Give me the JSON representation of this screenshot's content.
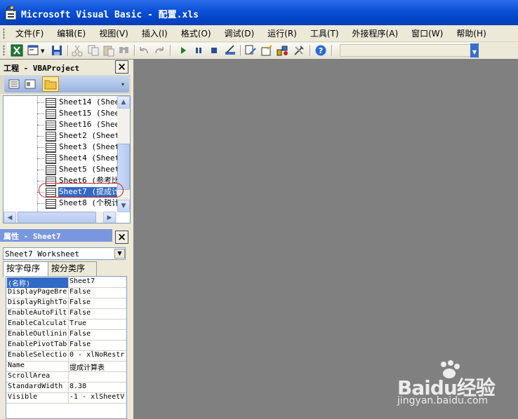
{
  "window": {
    "title": "Microsoft Visual Basic - 配置.xls"
  },
  "menu": [
    "文件(F)",
    "编辑(E)",
    "视图(V)",
    "插入(I)",
    "格式(O)",
    "调试(D)",
    "运行(R)",
    "工具(T)",
    "外接程序(A)",
    "窗口(W)",
    "帮助(H)"
  ],
  "toolbar": {
    "icons": [
      "excel-icon",
      "insert-userform-icon",
      "save-icon",
      "cut-icon",
      "copy-icon",
      "paste-icon",
      "find-icon",
      "undo-icon",
      "redo-icon",
      "run-icon",
      "break-icon",
      "reset-icon",
      "design-mode-icon",
      "project-explorer-icon",
      "properties-window-icon",
      "object-browser-icon",
      "toolbox-icon",
      "help-icon"
    ]
  },
  "project": {
    "title": "工程 - VBAProject",
    "close_label": "×",
    "items": [
      {
        "label": "Sheet14 (Shee"
      },
      {
        "label": "Sheet15 (Shee"
      },
      {
        "label": "Sheet16 (Shee"
      },
      {
        "label": "Sheet2 (Sheet"
      },
      {
        "label": "Sheet3 (Sheet"
      },
      {
        "label": "Sheet4 (Sheet"
      },
      {
        "label": "Sheet5 (Sheet"
      },
      {
        "label": "Sheet6 (参考比"
      },
      {
        "label": "Sheet7 (提成计"
      },
      {
        "label": "Sheet8 (个税计"
      }
    ],
    "selected_item": "Sheet7 (提成计"
  },
  "properties": {
    "title": "属性 - Sheet7",
    "close_label": "×",
    "object_combo": "Sheet7 Worksheet",
    "tabs": [
      "按字母序",
      "按分类序"
    ],
    "rows": [
      {
        "name": "(名称)",
        "value": "Sheet7"
      },
      {
        "name": "DisplayPageBre",
        "value": "False"
      },
      {
        "name": "DisplayRightTo",
        "value": "False"
      },
      {
        "name": "EnableAutoFilt",
        "value": "False"
      },
      {
        "name": "EnableCalculat",
        "value": "True"
      },
      {
        "name": "EnableOutlinin",
        "value": "False"
      },
      {
        "name": "EnablePivotTab",
        "value": "False"
      },
      {
        "name": "EnableSelectio",
        "value": "0 - xlNoRestr"
      },
      {
        "name": "Name",
        "value": "提成计算表"
      },
      {
        "name": "ScrollArea",
        "value": ""
      },
      {
        "name": "StandardWidth",
        "value": "8.38"
      },
      {
        "name": "Visible",
        "value": "-1 - xlSheetV"
      }
    ]
  },
  "watermark": {
    "logo": "Baidu经验",
    "url": "jingyan.baidu.com"
  }
}
